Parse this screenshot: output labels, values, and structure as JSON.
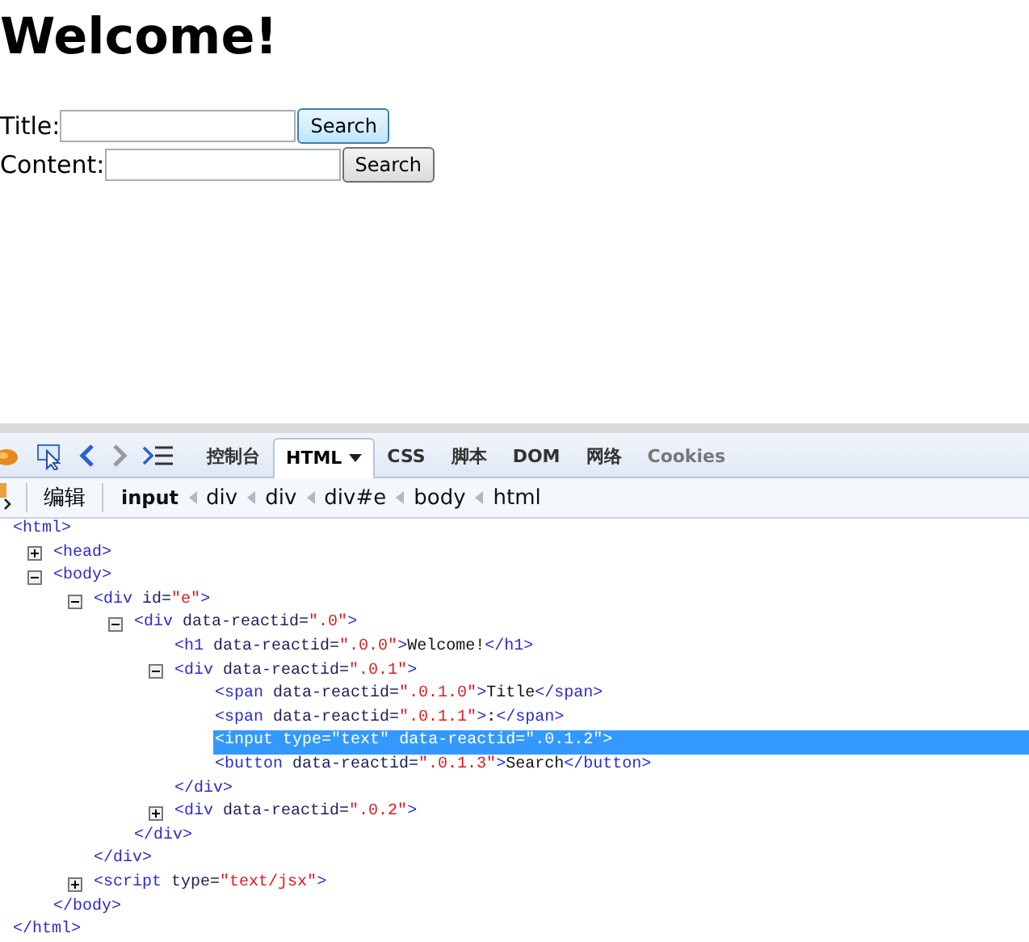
{
  "page": {
    "heading": "Welcome!",
    "rows": [
      {
        "label": "Title:",
        "button": "Search",
        "highlighted": true
      },
      {
        "label": "Content:",
        "button": "Search",
        "highlighted": false
      }
    ]
  },
  "devtools": {
    "history_buttons": [
      {
        "disabled": false
      },
      {
        "disabled": true
      }
    ],
    "tabs": [
      {
        "label": "控制台",
        "selected": false,
        "disabled": false
      },
      {
        "label": "HTML",
        "selected": true,
        "disabled": false,
        "dropdown": true
      },
      {
        "label": "CSS",
        "selected": false,
        "disabled": false
      },
      {
        "label": "脚本",
        "selected": false,
        "disabled": false
      },
      {
        "label": "DOM",
        "selected": false,
        "disabled": false
      },
      {
        "label": "网络",
        "selected": false,
        "disabled": false
      },
      {
        "label": "Cookies",
        "selected": false,
        "disabled": true
      }
    ],
    "edit_button": "编辑",
    "breadcrumb": [
      {
        "label": "input",
        "selected": true
      },
      {
        "label": "div",
        "selected": false
      },
      {
        "label": "div",
        "selected": false
      },
      {
        "label": "div#e",
        "selected": false
      },
      {
        "label": "body",
        "selected": false
      },
      {
        "label": "html",
        "selected": false
      }
    ],
    "tree": {
      "kind": "root",
      "open": "<html",
      "end": ">",
      "close": "</html>",
      "selected": false,
      "children": [
        {
          "kind": "expandable",
          "expanded": false,
          "open": "<head",
          "end": ">",
          "selected": false
        },
        {
          "kind": "expandable",
          "expanded": true,
          "open": "<body",
          "end": ">",
          "close": "</body>",
          "selected": false,
          "children": [
            {
              "kind": "expandable",
              "expanded": true,
              "open": "<div",
              "attrs": [
                {
                  "name": "id=",
                  "value": "\"e\""
                }
              ],
              "end": ">",
              "close": "</div>",
              "selected": false,
              "children": [
                {
                  "kind": "expandable",
                  "expanded": true,
                  "open": "<div",
                  "attrs": [
                    {
                      "name": "data-reactid=",
                      "value": "\".0\""
                    }
                  ],
                  "end": ">",
                  "close": "</div>",
                  "selected": false,
                  "children": [
                    {
                      "kind": "leaf",
                      "open": "<h1",
                      "attrs": [
                        {
                          "name": "data-reactid=",
                          "value": "\".0.0\""
                        }
                      ],
                      "end": ">",
                      "text": "Welcome!",
                      "inline_close": "</h1>",
                      "selected": false
                    },
                    {
                      "kind": "expandable",
                      "expanded": true,
                      "open": "<div",
                      "attrs": [
                        {
                          "name": "data-reactid=",
                          "value": "\".0.1\""
                        }
                      ],
                      "end": ">",
                      "close": "</div>",
                      "selected": false,
                      "children": [
                        {
                          "kind": "leaf",
                          "open": "<span",
                          "attrs": [
                            {
                              "name": "data-reactid=",
                              "value": "\".0.1.0\""
                            }
                          ],
                          "end": ">",
                          "text": "Title",
                          "inline_close": "</span>",
                          "selected": false
                        },
                        {
                          "kind": "leaf",
                          "open": "<span",
                          "attrs": [
                            {
                              "name": "data-reactid=",
                              "value": "\".0.1.1\""
                            }
                          ],
                          "end": ">",
                          "text": ":",
                          "inline_close": "</span>",
                          "selected": false
                        },
                        {
                          "kind": "leaf",
                          "open": "<input",
                          "attrs": [
                            {
                              "name": "type=",
                              "value": "\"text\""
                            },
                            {
                              "name": "data-reactid=",
                              "value": "\".0.1.2\""
                            }
                          ],
                          "end": ">",
                          "selected": true
                        },
                        {
                          "kind": "leaf",
                          "open": "<button",
                          "attrs": [
                            {
                              "name": "data-reactid=",
                              "value": "\".0.1.3\""
                            }
                          ],
                          "end": ">",
                          "text": "Search",
                          "inline_close": "</button>",
                          "selected": false
                        }
                      ]
                    },
                    {
                      "kind": "expandable",
                      "expanded": false,
                      "open": "<div",
                      "attrs": [
                        {
                          "name": "data-reactid=",
                          "value": "\".0.2\""
                        }
                      ],
                      "end": ">",
                      "selected": false
                    }
                  ]
                }
              ]
            },
            {
              "kind": "expandable",
              "expanded": false,
              "open": "<script",
              "attrs": [
                {
                  "name": "type=",
                  "value": "\"text/jsx\""
                }
              ],
              "end": ">",
              "selected": false
            }
          ]
        }
      ]
    }
  }
}
